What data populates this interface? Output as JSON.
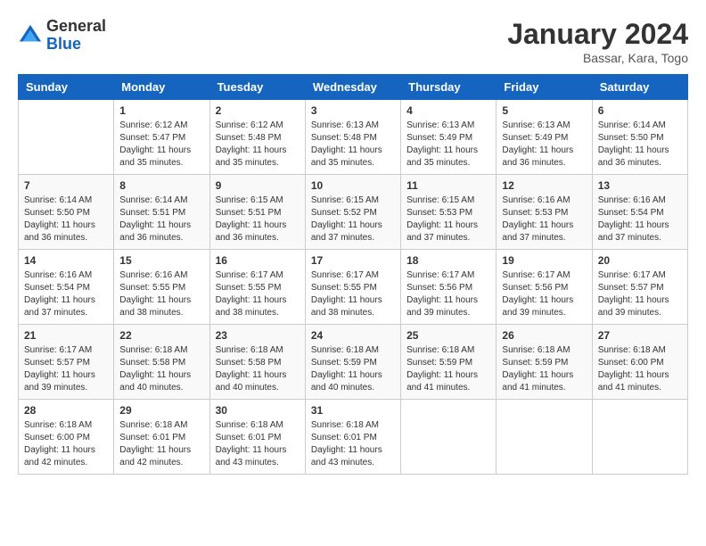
{
  "header": {
    "logo_general": "General",
    "logo_blue": "Blue",
    "month_title": "January 2024",
    "subtitle": "Bassar, Kara, Togo"
  },
  "columns": [
    "Sunday",
    "Monday",
    "Tuesday",
    "Wednesday",
    "Thursday",
    "Friday",
    "Saturday"
  ],
  "weeks": [
    [
      {
        "day": "",
        "sunrise": "",
        "sunset": "",
        "daylight": ""
      },
      {
        "day": "1",
        "sunrise": "Sunrise: 6:12 AM",
        "sunset": "Sunset: 5:47 PM",
        "daylight": "Daylight: 11 hours and 35 minutes."
      },
      {
        "day": "2",
        "sunrise": "Sunrise: 6:12 AM",
        "sunset": "Sunset: 5:48 PM",
        "daylight": "Daylight: 11 hours and 35 minutes."
      },
      {
        "day": "3",
        "sunrise": "Sunrise: 6:13 AM",
        "sunset": "Sunset: 5:48 PM",
        "daylight": "Daylight: 11 hours and 35 minutes."
      },
      {
        "day": "4",
        "sunrise": "Sunrise: 6:13 AM",
        "sunset": "Sunset: 5:49 PM",
        "daylight": "Daylight: 11 hours and 35 minutes."
      },
      {
        "day": "5",
        "sunrise": "Sunrise: 6:13 AM",
        "sunset": "Sunset: 5:49 PM",
        "daylight": "Daylight: 11 hours and 36 minutes."
      },
      {
        "day": "6",
        "sunrise": "Sunrise: 6:14 AM",
        "sunset": "Sunset: 5:50 PM",
        "daylight": "Daylight: 11 hours and 36 minutes."
      }
    ],
    [
      {
        "day": "7",
        "sunrise": "Sunrise: 6:14 AM",
        "sunset": "Sunset: 5:50 PM",
        "daylight": "Daylight: 11 hours and 36 minutes."
      },
      {
        "day": "8",
        "sunrise": "Sunrise: 6:14 AM",
        "sunset": "Sunset: 5:51 PM",
        "daylight": "Daylight: 11 hours and 36 minutes."
      },
      {
        "day": "9",
        "sunrise": "Sunrise: 6:15 AM",
        "sunset": "Sunset: 5:51 PM",
        "daylight": "Daylight: 11 hours and 36 minutes."
      },
      {
        "day": "10",
        "sunrise": "Sunrise: 6:15 AM",
        "sunset": "Sunset: 5:52 PM",
        "daylight": "Daylight: 11 hours and 37 minutes."
      },
      {
        "day": "11",
        "sunrise": "Sunrise: 6:15 AM",
        "sunset": "Sunset: 5:53 PM",
        "daylight": "Daylight: 11 hours and 37 minutes."
      },
      {
        "day": "12",
        "sunrise": "Sunrise: 6:16 AM",
        "sunset": "Sunset: 5:53 PM",
        "daylight": "Daylight: 11 hours and 37 minutes."
      },
      {
        "day": "13",
        "sunrise": "Sunrise: 6:16 AM",
        "sunset": "Sunset: 5:54 PM",
        "daylight": "Daylight: 11 hours and 37 minutes."
      }
    ],
    [
      {
        "day": "14",
        "sunrise": "Sunrise: 6:16 AM",
        "sunset": "Sunset: 5:54 PM",
        "daylight": "Daylight: 11 hours and 37 minutes."
      },
      {
        "day": "15",
        "sunrise": "Sunrise: 6:16 AM",
        "sunset": "Sunset: 5:55 PM",
        "daylight": "Daylight: 11 hours and 38 minutes."
      },
      {
        "day": "16",
        "sunrise": "Sunrise: 6:17 AM",
        "sunset": "Sunset: 5:55 PM",
        "daylight": "Daylight: 11 hours and 38 minutes."
      },
      {
        "day": "17",
        "sunrise": "Sunrise: 6:17 AM",
        "sunset": "Sunset: 5:55 PM",
        "daylight": "Daylight: 11 hours and 38 minutes."
      },
      {
        "day": "18",
        "sunrise": "Sunrise: 6:17 AM",
        "sunset": "Sunset: 5:56 PM",
        "daylight": "Daylight: 11 hours and 39 minutes."
      },
      {
        "day": "19",
        "sunrise": "Sunrise: 6:17 AM",
        "sunset": "Sunset: 5:56 PM",
        "daylight": "Daylight: 11 hours and 39 minutes."
      },
      {
        "day": "20",
        "sunrise": "Sunrise: 6:17 AM",
        "sunset": "Sunset: 5:57 PM",
        "daylight": "Daylight: 11 hours and 39 minutes."
      }
    ],
    [
      {
        "day": "21",
        "sunrise": "Sunrise: 6:17 AM",
        "sunset": "Sunset: 5:57 PM",
        "daylight": "Daylight: 11 hours and 39 minutes."
      },
      {
        "day": "22",
        "sunrise": "Sunrise: 6:18 AM",
        "sunset": "Sunset: 5:58 PM",
        "daylight": "Daylight: 11 hours and 40 minutes."
      },
      {
        "day": "23",
        "sunrise": "Sunrise: 6:18 AM",
        "sunset": "Sunset: 5:58 PM",
        "daylight": "Daylight: 11 hours and 40 minutes."
      },
      {
        "day": "24",
        "sunrise": "Sunrise: 6:18 AM",
        "sunset": "Sunset: 5:59 PM",
        "daylight": "Daylight: 11 hours and 40 minutes."
      },
      {
        "day": "25",
        "sunrise": "Sunrise: 6:18 AM",
        "sunset": "Sunset: 5:59 PM",
        "daylight": "Daylight: 11 hours and 41 minutes."
      },
      {
        "day": "26",
        "sunrise": "Sunrise: 6:18 AM",
        "sunset": "Sunset: 5:59 PM",
        "daylight": "Daylight: 11 hours and 41 minutes."
      },
      {
        "day": "27",
        "sunrise": "Sunrise: 6:18 AM",
        "sunset": "Sunset: 6:00 PM",
        "daylight": "Daylight: 11 hours and 41 minutes."
      }
    ],
    [
      {
        "day": "28",
        "sunrise": "Sunrise: 6:18 AM",
        "sunset": "Sunset: 6:00 PM",
        "daylight": "Daylight: 11 hours and 42 minutes."
      },
      {
        "day": "29",
        "sunrise": "Sunrise: 6:18 AM",
        "sunset": "Sunset: 6:01 PM",
        "daylight": "Daylight: 11 hours and 42 minutes."
      },
      {
        "day": "30",
        "sunrise": "Sunrise: 6:18 AM",
        "sunset": "Sunset: 6:01 PM",
        "daylight": "Daylight: 11 hours and 43 minutes."
      },
      {
        "day": "31",
        "sunrise": "Sunrise: 6:18 AM",
        "sunset": "Sunset: 6:01 PM",
        "daylight": "Daylight: 11 hours and 43 minutes."
      },
      {
        "day": "",
        "sunrise": "",
        "sunset": "",
        "daylight": ""
      },
      {
        "day": "",
        "sunrise": "",
        "sunset": "",
        "daylight": ""
      },
      {
        "day": "",
        "sunrise": "",
        "sunset": "",
        "daylight": ""
      }
    ]
  ]
}
